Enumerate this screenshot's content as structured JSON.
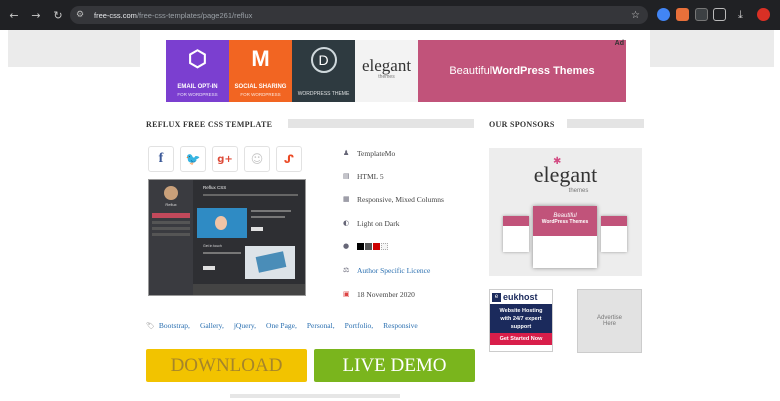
{
  "browser": {
    "url_host": "free-css.com",
    "url_path": "/free-css-templates/page261/reflux"
  },
  "ad_banner": {
    "label": "Ad",
    "tiles": [
      {
        "title": "EMAIL OPT-IN",
        "sub": "FOR WORDPRESS",
        "color": "#7b3fd0"
      },
      {
        "title": "SOCIAL SHARING",
        "sub": "FOR WORDPRESS",
        "color": "#f26522"
      },
      {
        "title": "WORDPRESS THEME",
        "color": "#2e3a40"
      }
    ],
    "brand": "elegant",
    "brand_sub": "themes",
    "tagline_pre": "Beautiful ",
    "tagline_bold": "WordPress Themes",
    "tagline_color": "#c1537a"
  },
  "template": {
    "section_title": "REFLUX FREE CSS TEMPLATE",
    "author": "TemplateMo",
    "html_version": "HTML 5",
    "layout": "Responsive, Mixed Columns",
    "theme": "Light on Dark",
    "licence": "Author Specific Licence",
    "date": "18 November 2020",
    "swatches": [
      "#000000",
      "#555555",
      "#cc0000",
      "#f5f5f5"
    ],
    "tags": [
      "Bootstrap,",
      "Gallery,",
      "jQuery,",
      "One Page,",
      "Personal,",
      "Portfolio,",
      "Responsive"
    ],
    "download_label": "DOWNLOAD",
    "live_demo_label": "LIVE DEMO"
  },
  "preview": {
    "name": "Reflux",
    "heading": "Reflux CSS",
    "section": "Get in touch"
  },
  "sponsors": {
    "title": "OUR SPONSORS",
    "elegant": {
      "brand": "elegant",
      "sub": "themes",
      "caption_1": "Beautiful",
      "caption_2": "WordPress Themes"
    },
    "eukhost": {
      "brand": "eukhost",
      "line1": "Website Hosting",
      "line2": "with 24/7 expert",
      "line3": "support",
      "cta": "Get Started Now"
    },
    "advertise": "Advertise Here"
  },
  "colors": {
    "download": "#f2c300",
    "live_demo": "#7ab51d",
    "facebook": "#3b5998",
    "twitter": "#1da1f2",
    "google": "#dd4b39",
    "reddit": "#c6c6c6",
    "stumble": "#eb4924"
  }
}
